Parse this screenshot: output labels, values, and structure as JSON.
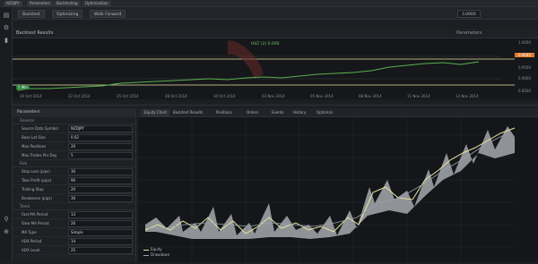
{
  "topbar": {
    "tabs": [
      "NZDJPY",
      "Parameters",
      "Backtesting",
      "Optimization"
    ]
  },
  "left_icons": [
    "chart-icon",
    "settings-icon",
    "bookmark-icon"
  ],
  "tabrow": {
    "tabs": [
      "Backtest",
      "Optimizing",
      "Walk Forward"
    ],
    "right_value": "3.0000"
  },
  "optrow": {
    "label": "Backtest Results",
    "right_label": "Parameters"
  },
  "chart_top": {
    "label": "HILT (2) 0.000",
    "left_badge": "5 Min",
    "y_ticks": [
      "1.0000",
      "0.9500",
      "0.9000",
      "0.8500"
    ],
    "price_tag": "0.9185",
    "x_ticks": [
      "20 Oct 2014",
      "22 Oct 2014",
      "25 Oct 2014",
      "28 Oct 2014",
      "30 Oct 2014",
      "03 Nov 2014",
      "05 Nov 2014",
      "08 Nov 2014",
      "11 Nov 2014",
      "13 Nov 2014"
    ]
  },
  "params": {
    "title": "Parameters",
    "sections": [
      {
        "name": "General",
        "rows": [
          {
            "label": "Source Data Symbol",
            "value": "NZDJPY"
          },
          {
            "label": "Base Lot Size",
            "value": "0.02"
          },
          {
            "label": "Max Positions",
            "value": "20"
          },
          {
            "label": "Max Trades Per Day",
            "value": "5"
          }
        ]
      },
      {
        "name": "Risk",
        "rows": [
          {
            "label": "Stop Loss (pips)",
            "value": "30"
          },
          {
            "label": "Take Profit (pips)",
            "value": "90"
          },
          {
            "label": "Trailing Stop",
            "value": "20"
          },
          {
            "label": "Breakeven (pips)",
            "value": "30"
          }
        ]
      },
      {
        "name": "Trend",
        "rows": [
          {
            "label": "Fast MA Period",
            "value": "13"
          },
          {
            "label": "Slow MA Period",
            "value": "26"
          },
          {
            "label": "MA Type",
            "value": "Simple"
          },
          {
            "label": "ADX Period",
            "value": "14"
          },
          {
            "label": "ADX Level",
            "value": "25"
          }
        ]
      }
    ]
  },
  "bottom_tabs": [
    "Equity Chart",
    "Backtest Results",
    "Positions",
    "Orders",
    "Events",
    "History",
    "Optimize"
  ],
  "bottom_chart": {
    "legend": [
      "Equity",
      "Drawdown"
    ],
    "colors": {
      "equity": "#e8e4a0",
      "balance": "#9aa0a8",
      "fill": "#b8bcc2"
    }
  }
}
